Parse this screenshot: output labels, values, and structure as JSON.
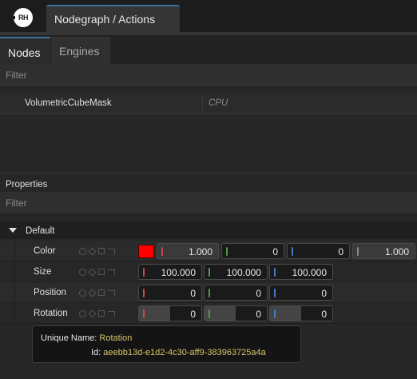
{
  "app": {
    "logo_text": "RH"
  },
  "document_tab": {
    "title": "Nodegraph / Actions"
  },
  "panel_tabs": [
    {
      "label": "Nodes",
      "active": true
    },
    {
      "label": "Engines",
      "active": false
    }
  ],
  "nodes_panel": {
    "filter_placeholder": "Filter",
    "rows": [
      {
        "name": "VolumetricCubeMask",
        "engine": "CPU"
      }
    ]
  },
  "properties_panel": {
    "title": "Properties",
    "filter_placeholder": "Filter",
    "group": {
      "label": "Default",
      "expanded": true
    },
    "properties": [
      {
        "label": "Color",
        "swatch_color": "#ff0000",
        "values": [
          "1.000",
          "0",
          "0",
          "1.000"
        ]
      },
      {
        "label": "Size",
        "values": [
          "100.000",
          "100.000",
          "100.000"
        ]
      },
      {
        "label": "Position",
        "values": [
          "0",
          "0",
          "0"
        ]
      },
      {
        "label": "Rotation",
        "values": [
          "0",
          "0",
          "0"
        ]
      }
    ]
  },
  "tooltip": {
    "unique_name_label": "Unique Name:",
    "unique_name_value": "Rotation",
    "id_label": "Id:",
    "id_value": "aeebb13d-e1d2-4c30-aff9-383963725a4a"
  },
  "colors": {
    "accent": "#3d6f9e",
    "channel_r": "#c94a4a",
    "channel_g": "#4f9a4f",
    "channel_b": "#4a78c9",
    "channel_a": "#8a8a8a",
    "tooltip_value": "#d8c46a"
  },
  "icons": {
    "property_state": [
      "keyframe-ring-icon",
      "keyframe-diamond-icon",
      "expose-square-icon",
      "link-arrow-icon"
    ],
    "group_toggle": "chevron-down-icon"
  }
}
